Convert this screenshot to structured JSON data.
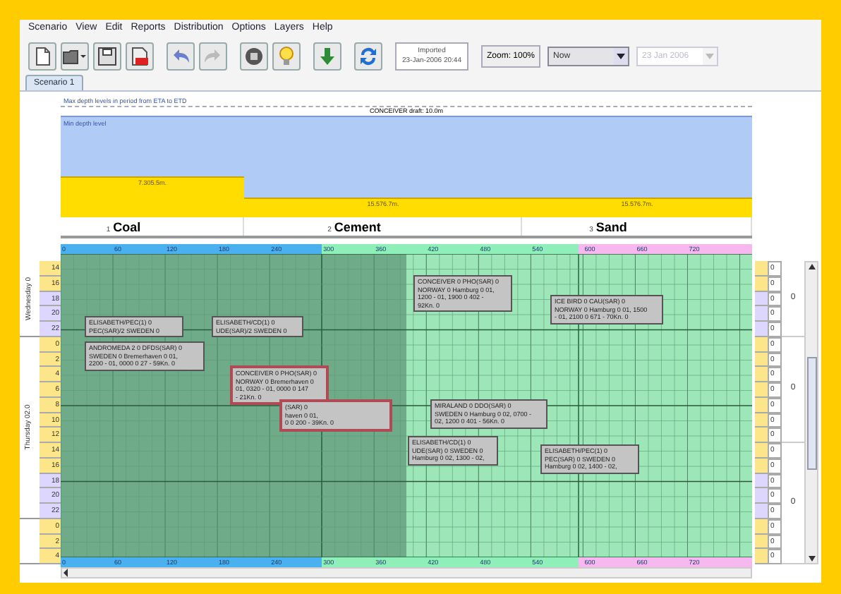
{
  "menu": [
    "Scenario",
    "View",
    "Edit",
    "Reports",
    "Distribution",
    "Options",
    "Layers",
    "Help"
  ],
  "toolbar": {
    "status_title": "Imported",
    "status_time": "23-Jan-2006 20:44",
    "zoom": "Zoom: 100%",
    "time_select": "Now",
    "date_select": {
      "value": "23 Jan 2006",
      "disabled": true
    }
  },
  "tabs": [
    {
      "label": "Scenario 1",
      "selected": true
    }
  ],
  "depth_chart": {
    "info": "Max depth levels in period from ETA to ETD",
    "min_label": "Min depth level",
    "vessel_draft": "CONCEIVER draft: 10.0m",
    "segments": [
      {
        "label": "7.305.5m."
      },
      {
        "label": "15.576.7m."
      },
      {
        "label": "15.576.7m."
      }
    ]
  },
  "berths": [
    {
      "number": "1",
      "name": "Coal"
    },
    {
      "number": "2",
      "name": "Cement"
    },
    {
      "number": "3",
      "name": "Sand"
    }
  ],
  "ruler_ticks": [
    "0",
    "60",
    "120",
    "180",
    "240",
    "300",
    "360",
    "420",
    "480",
    "540",
    "600",
    "660",
    "720"
  ],
  "bottom_ruler_ticks": [
    "0",
    "60",
    "120",
    "180",
    "240",
    "300",
    "360",
    "420",
    "480",
    "540",
    "600",
    "660",
    "720"
  ],
  "right_rows": [
    {
      "value": "0",
      "color": "#fde68a"
    },
    {
      "value": "0",
      "color": "#fde68a"
    },
    {
      "value": "0",
      "color": "#ddd6fe"
    },
    {
      "value": "0",
      "color": "#ddd6fe"
    },
    {
      "value": "0",
      "color": "#ddd6fe"
    },
    {
      "value": "0",
      "color": "#fde68a"
    },
    {
      "value": "0",
      "color": "#fde68a"
    },
    {
      "value": "0",
      "color": "#fde68a"
    },
    {
      "value": "0",
      "color": "#fde68a"
    },
    {
      "value": "0",
      "color": "#fde68a"
    },
    {
      "value": "0",
      "color": "#fde68a"
    },
    {
      "value": "0",
      "color": "#fde68a"
    },
    {
      "value": "0",
      "color": "#fde68a"
    },
    {
      "value": "0",
      "color": "#fde68a"
    },
    {
      "value": "0",
      "color": "#ddd6fe"
    },
    {
      "value": "0",
      "color": "#ddd6fe"
    },
    {
      "value": "0",
      "color": "#ddd6fe"
    },
    {
      "value": "0",
      "color": "#fde68a"
    },
    {
      "value": "0",
      "color": "#fde68a"
    },
    {
      "value": "0",
      "color": "#fde68a"
    }
  ],
  "days": [
    {
      "label": "Wednesday 0"
    },
    {
      "label": "Thursday 02.0"
    }
  ],
  "hours": [
    {
      "label": "14",
      "color": "#fde68a"
    },
    {
      "label": "16",
      "color": "#fde68a"
    },
    {
      "label": "18",
      "color": "#ddd6fe"
    },
    {
      "label": "20",
      "color": "#ddd6fe"
    },
    {
      "label": "22",
      "color": "#ddd6fe"
    },
    {
      "label": "0",
      "color": "#fde68a"
    },
    {
      "label": "2",
      "color": "#fde68a"
    },
    {
      "label": "4",
      "color": "#fde68a"
    },
    {
      "label": "6",
      "color": "#fde68a"
    },
    {
      "label": "8",
      "color": "#fde68a"
    },
    {
      "label": "10",
      "color": "#fde68a"
    },
    {
      "label": "12",
      "color": "#fde68a"
    },
    {
      "label": "14",
      "color": "#fde68a"
    },
    {
      "label": "16",
      "color": "#fde68a"
    },
    {
      "label": "18",
      "color": "#ddd6fe"
    },
    {
      "label": "20",
      "color": "#ddd6fe"
    },
    {
      "label": "22",
      "color": "#ddd6fe"
    },
    {
      "label": "0",
      "color": "#fde68a"
    },
    {
      "label": "2",
      "color": "#fde68a"
    },
    {
      "label": "4",
      "color": "#fde68a"
    }
  ],
  "vessels": [
    {
      "text": "ELISABETH/PEC(1) 0\nPEC(SAR)/2 SWEDEN 0",
      "conflict": false
    },
    {
      "text": "ELISABETH/CD(1) 0\nUDE(SAR)/2 SWEDEN 0",
      "conflict": false
    },
    {
      "text": "ANDROMEDA 2 0 DFDS(SAR) 0\nSWEDEN 0 Bremerhaven 0 01,\n2200 - 01, 0000 0 27 - 59Kn. 0",
      "conflict": false
    },
    {
      "text": "CONCEIVER 0 PHO(SAR) 0\nNORWAY 0 Bremerhaven 0\n01, 0320 - 01, 0000 0 147\n- 21Kn. 0",
      "conflict": true
    },
    {
      "text": "(SAR) 0\nhaven 0 01,\n0 0 200 - 39Kn. 0",
      "conflict": true
    },
    {
      "text": "CONCEIVER 0 PHO(SAR) 0\nNORWAY 0 Hamburg 0 01,\n1200 - 01, 1900 0 402 -\n92Kn. 0",
      "conflict": false
    },
    {
      "text": "ICE BIRD 0 CAU(SAR) 0\nNORWAY 0 Hamburg 0 01, 1500\n- 01, 2100 0 671 - 70Kn. 0",
      "conflict": false
    },
    {
      "text": "MIRALAND 0 DDO(SAR) 0\nSWEDEN 0 Hamburg 0 02, 0700 -\n02, 1200 0 401 - 56Kn. 0",
      "conflict": false
    },
    {
      "text": "ELISABETH/CD(1) 0\nUDE(SAR) 0 SWEDEN 0\nHamburg 0 02, 1300 - 02,",
      "conflict": false
    },
    {
      "text": "ELISABETH/PEC(1) 0\nPEC(SAR) 0 SWEDEN 0\nHamburg 0 02, 1400 - 02,",
      "conflict": false
    }
  ],
  "right_totals": [
    "0",
    "0",
    "0"
  ]
}
